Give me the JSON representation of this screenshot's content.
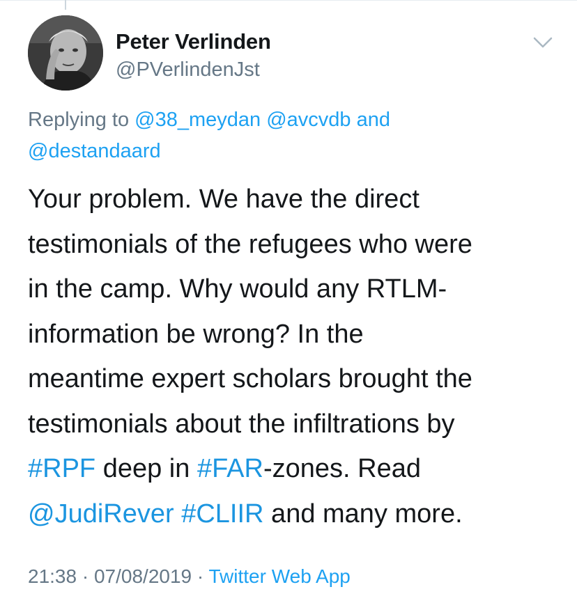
{
  "author": {
    "display_name": "Peter Verlinden",
    "handle": "@PVerlindenJst",
    "avatar_icon": "profile-photo"
  },
  "menu_icon": "chevron-down-icon",
  "reply": {
    "prefix": "Replying to",
    "mentions": [
      "@38_meydan",
      "@avcvdb"
    ],
    "joiner": "and",
    "last_mention": "@destandaard"
  },
  "tweet": {
    "lines": [
      [
        {
          "t": "Your problem. We have the direct"
        }
      ],
      [
        {
          "t": "testimonials of the refugees who were"
        }
      ],
      [
        {
          "t": "in the camp. Why would any RTLM-"
        }
      ],
      [
        {
          "t": "information be wrong? In the"
        }
      ],
      [
        {
          "t": "meantime expert scholars brought the"
        }
      ],
      [
        {
          "t": "testimonials about the infiltrations by"
        }
      ],
      [
        {
          "t": "#RPF",
          "link": true
        },
        {
          "t": " deep in "
        },
        {
          "t": "#FAR",
          "link": true
        },
        {
          "t": "-zones. Read"
        }
      ],
      [
        {
          "t": "@JudiRever",
          "link": true
        },
        {
          "t": " "
        },
        {
          "t": "#CLIIR",
          "link": true
        },
        {
          "t": " and many more."
        }
      ]
    ]
  },
  "meta": {
    "time": "21:38",
    "date": "07/08/2019",
    "separator": " · ",
    "source": "Twitter Web App"
  },
  "colors": {
    "link": "#1da1f2",
    "secondary_text": "#657786",
    "primary_text": "#14171a"
  }
}
